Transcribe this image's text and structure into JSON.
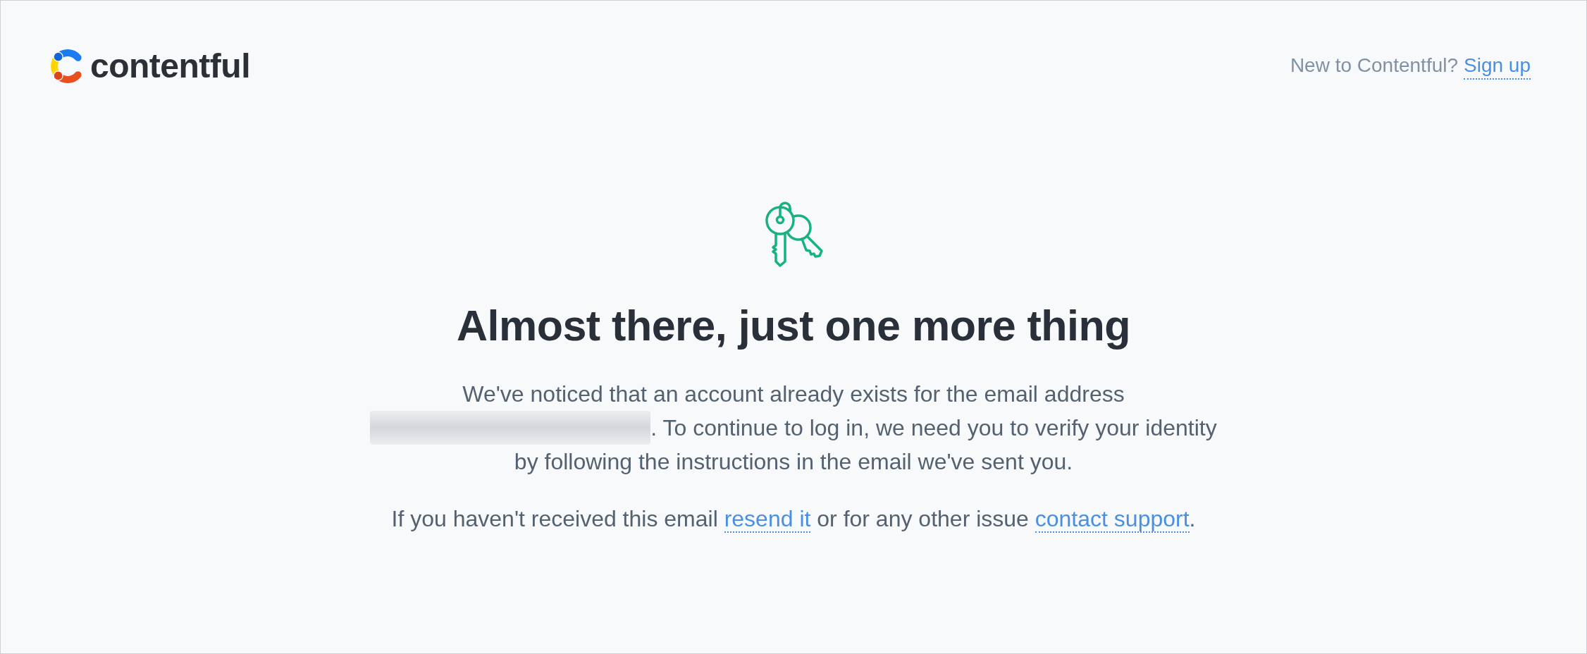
{
  "header": {
    "logo": {
      "text": "contentful"
    },
    "signup": {
      "prompt": "New to Contentful?",
      "link": "Sign up"
    }
  },
  "message": {
    "title": "Almost there, just one more thing",
    "text_before_email": "We've noticed that an account already exists for the email address",
    "text_after_email": ". To continue to log in, we need you to verify your identity by following the instructions in the email we've sent you.",
    "help": {
      "text_before_resend": "If you haven't received this email",
      "resend_link": "resend it",
      "text_before_support": "or for any other issue",
      "support_link": "contact support",
      "text_after_support": "."
    }
  }
}
